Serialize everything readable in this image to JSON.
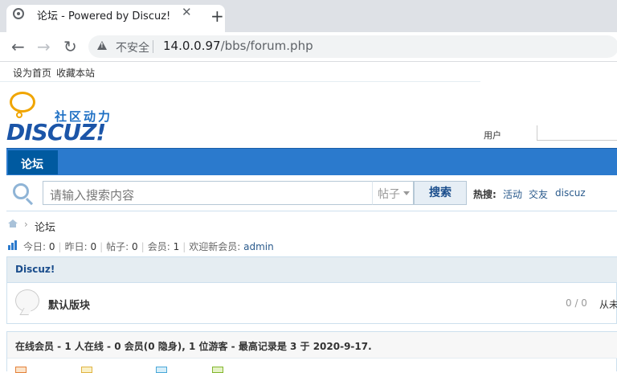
{
  "browser": {
    "tab_title": "论坛 - Powered by Discuz!",
    "close_glyph": "✕",
    "newtab_glyph": "+",
    "back_glyph": "←",
    "forward_glyph": "→",
    "reload_glyph": "↻",
    "insecure_label": "不安全",
    "url_host": "14.0.0.97",
    "url_path": "/bbs/forum.php"
  },
  "topbar": {
    "set_home": "设为首页",
    "bookmark": "收藏本站"
  },
  "logo": {
    "slogan": "社区动力",
    "word": "DISCUZ!"
  },
  "header_right": {
    "text": "用户"
  },
  "nav": {
    "active_label": "论坛"
  },
  "search": {
    "placeholder": "请输入搜索内容",
    "type": "帖子",
    "button": "搜索",
    "hot_label": "热搜:",
    "hot_links": [
      "活动",
      "交友",
      "discuz"
    ]
  },
  "breadcrumb": {
    "sep": "›",
    "current": "论坛"
  },
  "stats": {
    "today_label": "今日:",
    "today": "0",
    "yesterday_label": "昨日:",
    "yesterday": "0",
    "posts_label": "帖子:",
    "posts": "0",
    "members_label": "会员:",
    "members": "1",
    "welcome_label": "欢迎新会员:",
    "newest": "admin"
  },
  "category": {
    "title": "Discuz!",
    "forum_name": "默认版块",
    "count": "0 / 0",
    "last_post": "从未"
  },
  "online": {
    "summary": "在线会员 - 1 人在线 - 0 会员(0 隐身), 1 位游客 - 最高记录是 3 于 2020-9-17."
  },
  "colors": {
    "nav": "#2b7acd",
    "nav_active": "#005aa0",
    "link": "#2a5a8c"
  }
}
